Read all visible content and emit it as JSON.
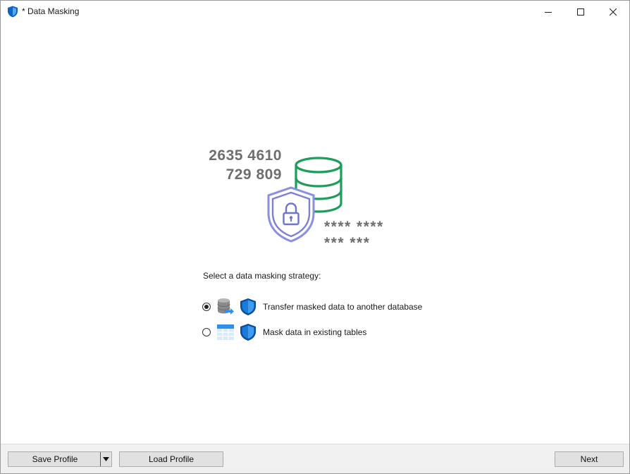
{
  "window": {
    "title": "* Data Masking",
    "icon": "shield-icon",
    "controls": [
      "minimize-icon",
      "maximize-icon",
      "close-icon"
    ]
  },
  "hero": {
    "number_line_1": "2635 4610",
    "number_line_2": "729 809",
    "masked_line_1": "**** ****",
    "masked_line_2": "*** ***",
    "database_icon": "database-icon",
    "shield_icon": "shield-lock-icon"
  },
  "strategy": {
    "prompt": "Select a data masking strategy:",
    "options": [
      {
        "label": "Transfer masked data to another database",
        "selected": true,
        "icons": [
          "database-transfer-icon",
          "shield-icon"
        ]
      },
      {
        "label": "Mask data in existing tables",
        "selected": false,
        "icons": [
          "table-icon",
          "shield-icon"
        ]
      }
    ]
  },
  "footer": {
    "save_profile_label": "Save Profile",
    "load_profile_label": "Load Profile",
    "next_label": "Next"
  },
  "colors": {
    "accent_blue": "#0a64c8",
    "shield_purple": "#7b7fd6",
    "db_green": "#1e9c5a",
    "digits_gray": "#6e6e6e",
    "footer_bg": "#f0f0f0"
  }
}
